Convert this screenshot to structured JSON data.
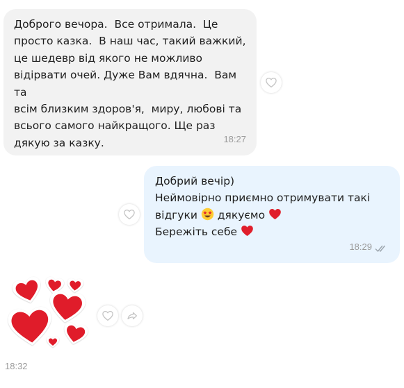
{
  "messages": {
    "incoming": {
      "text": "Доброго вечора.  Все отримала.  Це\nпросто казка.  В наш час, такий важкий,\nце шедевр від якого не можливо\nвідірвати очей. Дуже Вам вдячна.  Вам та\nвсім близким здоров'я,  миру, любові та\nвсього самого найкращого. Ще раз\nдякую за казку.",
      "time": "18:27"
    },
    "outgoing": {
      "line1": "Добрий вечір)",
      "line2": "Неймовірно приємно отримувати такі",
      "line3_before": "відгуки",
      "line3_after": "дякуємо",
      "line4": "Бережіть себе",
      "time": "18:29",
      "status": "read"
    },
    "sticker": {
      "description_icon": "hearts-sticker",
      "time": "18:32"
    }
  },
  "icons": {
    "reaction": "heart-outline-icon",
    "forward": "forward-arrow-icon",
    "read_receipt": "double-check-icon",
    "emoji_star_eyes": "star-struck-emoji",
    "emoji_heart": "red-heart-emoji"
  },
  "colors": {
    "incoming_bubble": "#f2f2f2",
    "outgoing_bubble": "#e9f4fe",
    "heart_red": "#e01e2b",
    "timestamp": "#9a9a9a"
  }
}
